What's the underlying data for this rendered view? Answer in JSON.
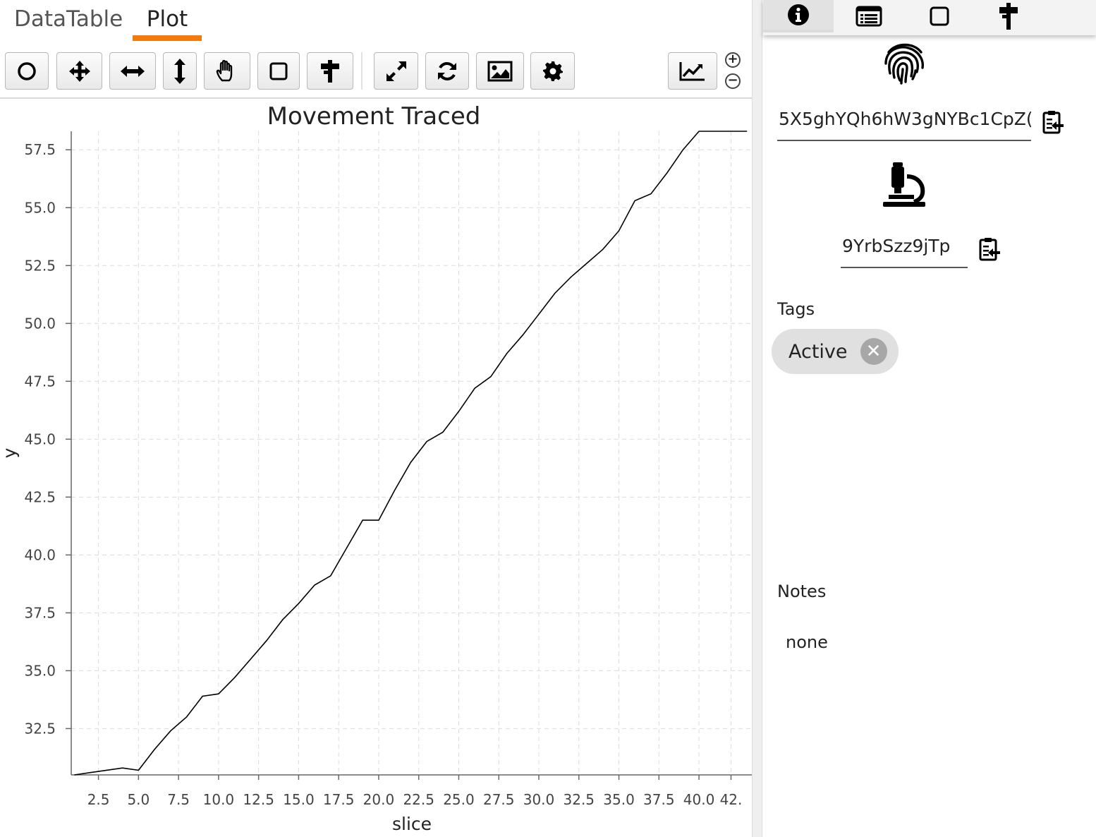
{
  "tabs": [
    {
      "label": "DataTable",
      "active": false
    },
    {
      "label": "Plot",
      "active": true
    }
  ],
  "accent_color": "#f37a0b",
  "toolbar": {
    "buttons": [
      {
        "name": "circle-tool",
        "icon": "circle-icon"
      },
      {
        "name": "pan-tool",
        "icon": "move-arrows-icon"
      },
      {
        "name": "pan-x-tool",
        "icon": "horizontal-arrows-icon"
      },
      {
        "name": "pan-y-tool",
        "icon": "vertical-arrows-icon"
      },
      {
        "name": "grab-tool",
        "icon": "hand-icon"
      },
      {
        "name": "select-tool",
        "icon": "square-icon"
      },
      {
        "name": "signpost-tool",
        "icon": "signpost-icon"
      },
      {
        "name": "expand-tool",
        "icon": "expand-icon"
      },
      {
        "name": "refresh-tool",
        "icon": "refresh-icon"
      },
      {
        "name": "image-tool",
        "icon": "image-icon"
      },
      {
        "name": "settings-tool",
        "icon": "gear-icon"
      },
      {
        "name": "chart-tool",
        "icon": "line-chart-icon"
      }
    ],
    "zoom_in": "+",
    "zoom_out": "−"
  },
  "chart_data": {
    "type": "line",
    "title": "Movement Traced",
    "xlabel": "slice",
    "ylabel": "y",
    "xlim": [
      0.8,
      43.3
    ],
    "ylim": [
      30.5,
      58.3
    ],
    "xticks": [
      "2.5",
      "5.0",
      "7.5",
      "10.0",
      "12.5",
      "15.0",
      "17.5",
      "20.0",
      "22.5",
      "25.0",
      "27.5",
      "30.0",
      "32.5",
      "35.0",
      "37.5",
      "40.0",
      "42."
    ],
    "yticks": [
      "32.5",
      "35.0",
      "37.5",
      "40.0",
      "42.5",
      "45.0",
      "47.5",
      "50.0",
      "52.5",
      "55.0",
      "57.5"
    ],
    "grid": true,
    "line_color": "#000000",
    "x": [
      1,
      2,
      3,
      4,
      5,
      6,
      7,
      8,
      9,
      10,
      11,
      12,
      13,
      14,
      15,
      16,
      17,
      18,
      19,
      20,
      21,
      22,
      23,
      24,
      25,
      26,
      27,
      28,
      29,
      30,
      31,
      32,
      33,
      34,
      35,
      36,
      37,
      38,
      39,
      40,
      41,
      42,
      43
    ],
    "y": [
      30.5,
      30.6,
      30.7,
      30.8,
      30.7,
      31.6,
      32.4,
      33.0,
      33.9,
      34.0,
      34.7,
      35.5,
      36.3,
      37.2,
      37.9,
      38.7,
      39.1,
      40.3,
      41.5,
      41.5,
      42.8,
      44.0,
      44.9,
      45.3,
      46.2,
      47.2,
      47.7,
      48.7,
      49.5,
      50.4,
      51.3,
      52.0,
      52.6,
      53.2,
      54.0,
      55.3,
      55.6,
      56.5,
      57.5,
      58.3,
      58.3,
      58.3,
      58.3
    ]
  },
  "sidebar": {
    "tabs": [
      {
        "icon": "info-icon",
        "active": true
      },
      {
        "icon": "list-icon",
        "active": false
      },
      {
        "icon": "square-icon",
        "active": false
      },
      {
        "icon": "signpost-icon",
        "active": false
      }
    ],
    "fingerprint_icon": "fingerprint-icon",
    "id_value": "5X5ghYQh6hW3gNYBc1CpZ(",
    "microscope_icon": "microscope-icon",
    "sample_id_value": "9YrbSzz9jTp",
    "tags_label": "Tags",
    "tags": [
      "Active"
    ],
    "tag_remove_symbol": "✕",
    "notes_label": "Notes",
    "notes_value": "none"
  }
}
